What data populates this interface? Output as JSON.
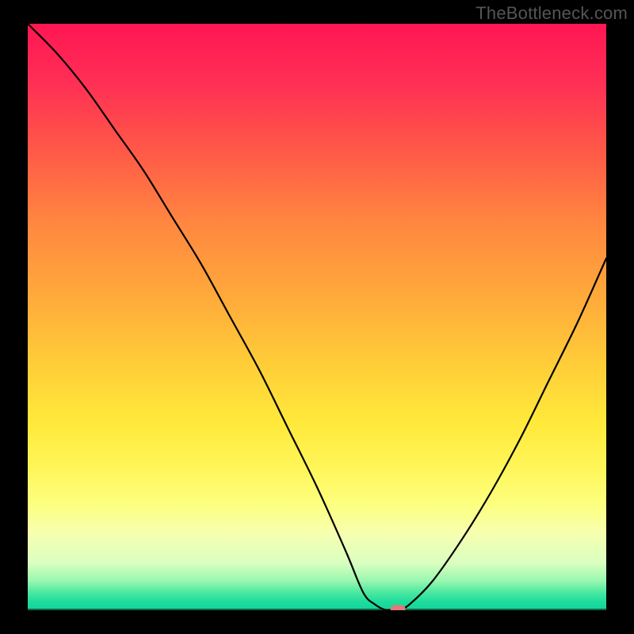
{
  "attribution": "TheBottleneck.com",
  "chart_data": {
    "type": "line",
    "title": "",
    "xlabel": "",
    "ylabel": "",
    "xlim": [
      0,
      100
    ],
    "ylim": [
      0,
      100
    ],
    "x": [
      0,
      5,
      10,
      15,
      20,
      25,
      30,
      35,
      40,
      45,
      50,
      55,
      58,
      60,
      62,
      64,
      66,
      70,
      75,
      80,
      85,
      90,
      95,
      100
    ],
    "values": [
      100,
      95,
      89,
      82,
      75,
      67,
      59,
      50,
      41,
      31,
      21,
      10,
      3,
      1,
      0,
      0,
      1,
      5,
      12,
      20,
      29,
      39,
      49,
      60
    ],
    "marker_x": 64,
    "marker_y": 0
  },
  "colors": {
    "gradient_top": "#ff1654",
    "gradient_mid": "#ffe93a",
    "gradient_bottom": "#14d39b",
    "curve": "#000000",
    "marker": "#e07a7a",
    "background": "#000000"
  }
}
